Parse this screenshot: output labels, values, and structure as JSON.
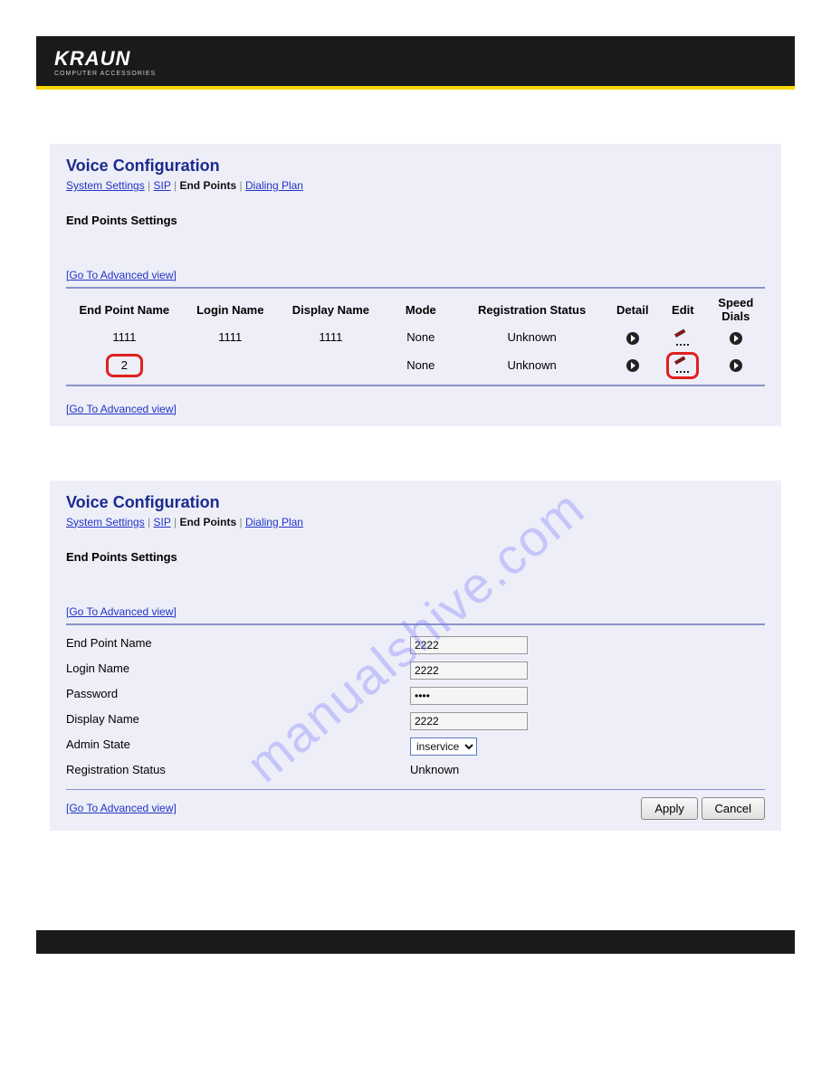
{
  "brand": {
    "name": "KRAUN",
    "tagline": "COMPUTER ACCESSORIES"
  },
  "watermark": "manualshive.com",
  "panel1": {
    "title": "Voice Configuration",
    "tabs": {
      "system": "System Settings",
      "sip": "SIP",
      "endpoints": "End Points",
      "dialing": "Dialing Plan",
      "sep": "|"
    },
    "subtitle": "End Points Settings",
    "adv": "[Go To Advanced view]",
    "headers": {
      "ep": "End Point Name",
      "login": "Login Name",
      "disp": "Display Name",
      "mode": "Mode",
      "reg": "Registration Status",
      "detail": "Detail",
      "edit": "Edit",
      "speed": "Speed Dials"
    },
    "rows": [
      {
        "ep": "1111",
        "login": "1111",
        "disp": "1111",
        "mode": "None",
        "reg": "Unknown",
        "hilite_ep": false,
        "hilite_edit": false
      },
      {
        "ep": "2",
        "login": "",
        "disp": "",
        "mode": "None",
        "reg": "Unknown",
        "hilite_ep": true,
        "hilite_edit": true
      }
    ]
  },
  "panel2": {
    "title": "Voice Configuration",
    "tabs": {
      "system": "System Settings",
      "sip": "SIP",
      "endpoints": "End Points",
      "dialing": "Dialing Plan",
      "sep": "|"
    },
    "subtitle": "End Points Settings",
    "adv": "[Go To Advanced view]",
    "form": {
      "ep_label": "End Point Name",
      "ep_val": "2222",
      "login_label": "Login Name",
      "login_val": "2222",
      "pw_label": "Password",
      "pw_val": "••••",
      "disp_label": "Display Name",
      "disp_val": "2222",
      "admin_label": "Admin State",
      "admin_val": "inservice",
      "reg_label": "Registration Status",
      "reg_val": "Unknown"
    },
    "buttons": {
      "apply": "Apply",
      "cancel": "Cancel"
    }
  }
}
